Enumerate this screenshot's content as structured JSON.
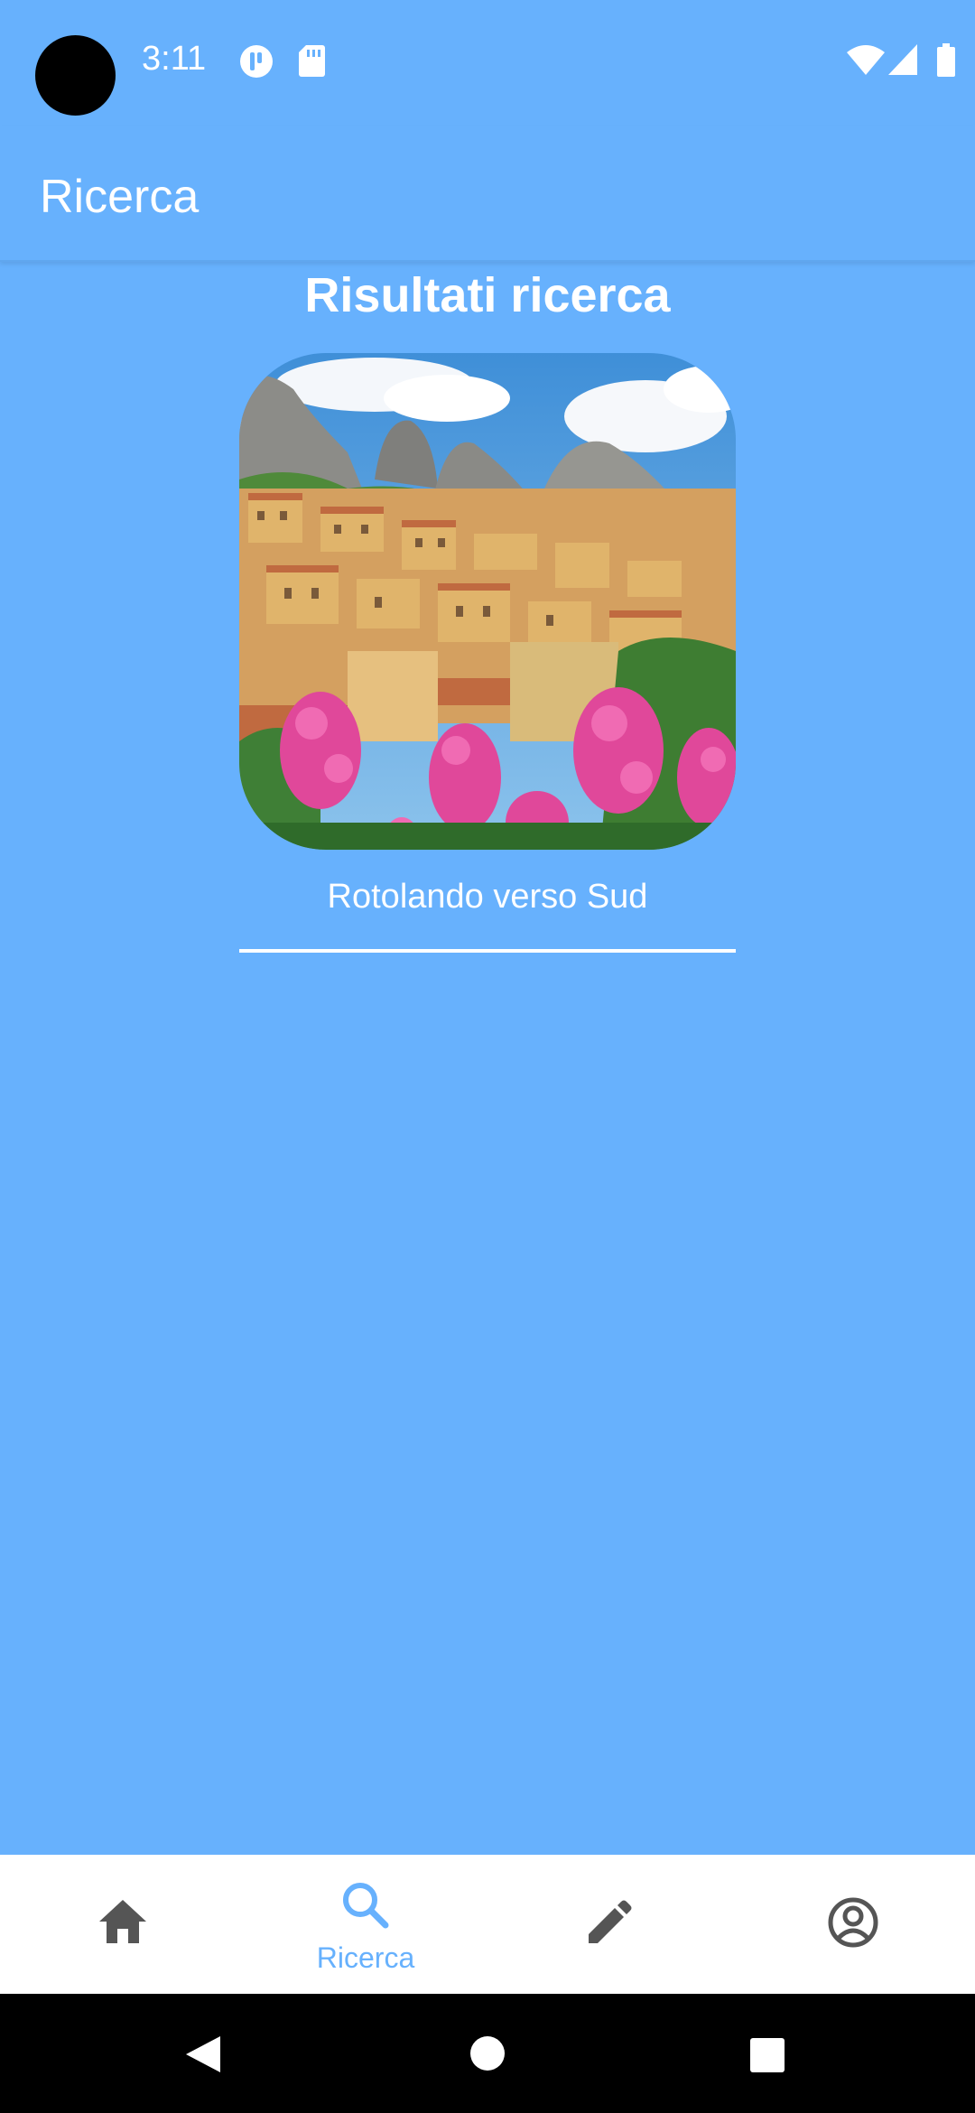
{
  "status_bar": {
    "time": "3:11",
    "left_icons": [
      "notification-app-icon",
      "sd-card-icon"
    ],
    "right_icons": [
      "wifi-icon",
      "signal-icon",
      "battery-icon"
    ]
  },
  "app_bar": {
    "title": "Ricerca"
  },
  "content": {
    "results_title": "Risultati ricerca",
    "result": {
      "title": "Rotolando verso Sud",
      "image": "hill-town-photo"
    }
  },
  "bottom_nav": {
    "items": [
      {
        "icon": "home-icon",
        "label": "",
        "active": false
      },
      {
        "icon": "search-icon",
        "label": "Ricerca",
        "active": true
      },
      {
        "icon": "pencil-icon",
        "label": "",
        "active": false
      },
      {
        "icon": "account-circle-icon",
        "label": "",
        "active": false
      }
    ],
    "active_color": "#67b1fd",
    "inactive_color": "#555555"
  },
  "system_nav": [
    "back-icon",
    "home-circle-icon",
    "recents-icon"
  ],
  "colors": {
    "background": "#67b1fd",
    "surface": "#ffffff"
  }
}
